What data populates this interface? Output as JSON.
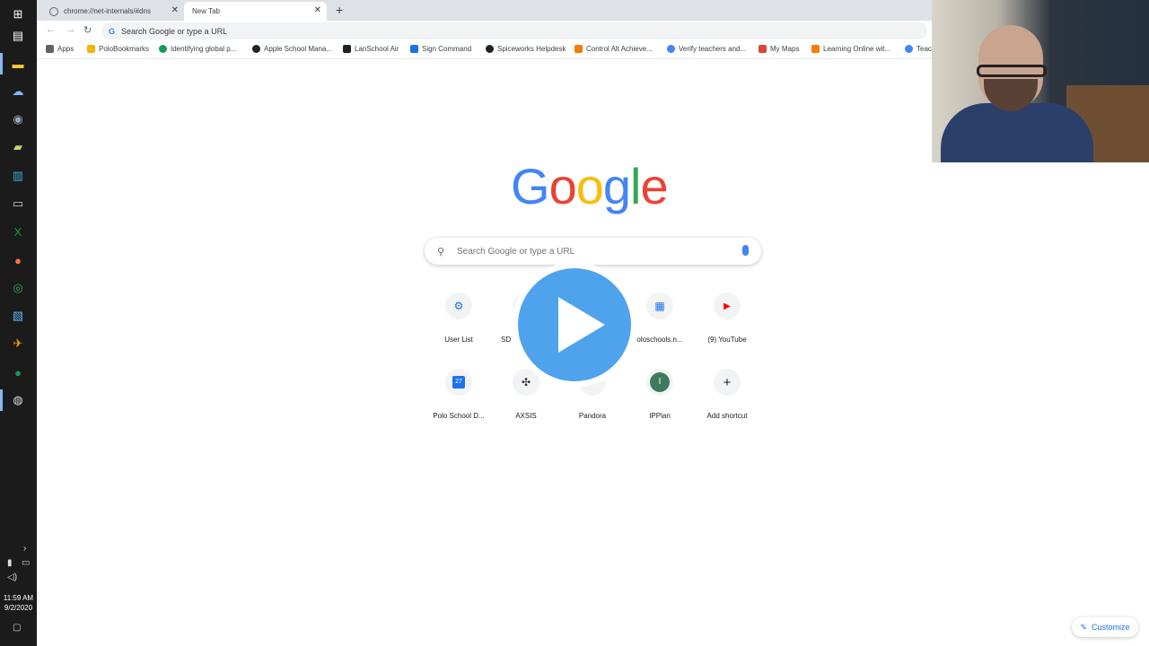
{
  "taskbar": {
    "icons": [
      "windows-icon",
      "task-view-icon",
      "file-explorer-icon",
      "network-icon",
      "security-icon",
      "app-icon",
      "store-icon",
      "terminal-icon",
      "excel-icon",
      "firefox-icon",
      "chrome-icon",
      "powershell-icon",
      "app2-icon",
      "hangouts-icon",
      "obs-icon"
    ],
    "time": "11:59 AM",
    "date": "9/2/2020"
  },
  "tabs": [
    {
      "label": "chrome://net-internals/#dns",
      "active": false
    },
    {
      "label": "New Tab",
      "active": true
    }
  ],
  "omnibox": {
    "placeholder": "Search Google or type a URL"
  },
  "bookmarks": [
    {
      "label": "Apps",
      "color": "#5f6368"
    },
    {
      "label": "PoloBookmarks",
      "color": "#f4b400"
    },
    {
      "label": "Identifying global p...",
      "color": "#0f9d58"
    },
    {
      "label": "Apple School Mana...",
      "color": "#202124"
    },
    {
      "label": "LanSchool Air",
      "color": "#202124"
    },
    {
      "label": "Sign Command",
      "color": "#1a73e8"
    },
    {
      "label": "Spiceworks Helpdesk",
      "color": "#202124"
    },
    {
      "label": "Control Alt Achieve...",
      "color": "#f57c00"
    },
    {
      "label": "Verify teachers and...",
      "color": "#4285f4"
    },
    {
      "label": "My Maps",
      "color": "#db4437"
    },
    {
      "label": "Learning Online wit...",
      "color": "#f57c00"
    },
    {
      "label": "Teac",
      "color": "#4285f4"
    }
  ],
  "logo": {
    "letters": [
      "G",
      "o",
      "o",
      "g",
      "l",
      "e"
    ],
    "colors": [
      "#4285f4",
      "#ea4335",
      "#fbbc05",
      "#4285f4",
      "#34a853",
      "#ea4335"
    ]
  },
  "search": {
    "placeholder": "Search Google or type a URL"
  },
  "shortcuts": [
    {
      "label": "User List",
      "glyph": "⚙",
      "color": "#1a73e8"
    },
    {
      "label": "SD",
      "glyph": "",
      "color": "#5f6368"
    },
    {
      "label": "",
      "glyph": "",
      "color": "#5f6368"
    },
    {
      "label": "oloschools.n...",
      "glyph": "▦",
      "color": "#1a73e8"
    },
    {
      "label": "(9) YouTube",
      "glyph": "▶",
      "color": "#ff0000"
    },
    {
      "label": "Polo School D...",
      "glyph": "27",
      "color": "#1a73e8"
    },
    {
      "label": "AXSIS",
      "glyph": "✣",
      "color": "#202124"
    },
    {
      "label": "Pandora",
      "glyph": "",
      "color": "#5f6368"
    },
    {
      "label": "IPPlan",
      "glyph": "I",
      "color": "#ffffff"
    },
    {
      "label": "Add shortcut",
      "glyph": "+",
      "color": "#202124"
    }
  ],
  "customize": {
    "label": "Customize"
  }
}
